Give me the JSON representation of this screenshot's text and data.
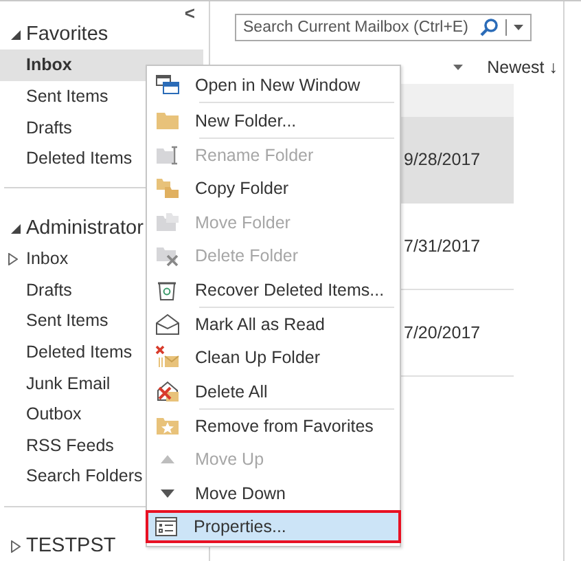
{
  "sidebar": {
    "collapse_button": "<",
    "groups": [
      {
        "title": "Favorites",
        "expanded": true,
        "items": [
          {
            "label": "Inbox",
            "selected": true,
            "has_children": false
          },
          {
            "label": "Sent Items",
            "selected": false,
            "has_children": false
          },
          {
            "label": "Drafts",
            "selected": false,
            "has_children": false
          },
          {
            "label": "Deleted Items",
            "selected": false,
            "has_children": false
          }
        ]
      },
      {
        "title": "Administrator",
        "expanded": true,
        "items": [
          {
            "label": "Inbox",
            "selected": false,
            "has_children": true
          },
          {
            "label": "Drafts",
            "selected": false,
            "has_children": false
          },
          {
            "label": "Sent Items",
            "selected": false,
            "has_children": false
          },
          {
            "label": "Deleted Items",
            "selected": false,
            "has_children": false
          },
          {
            "label": "Junk Email",
            "selected": false,
            "has_children": false
          },
          {
            "label": "Outbox",
            "selected": false,
            "has_children": false
          },
          {
            "label": "RSS Feeds",
            "selected": false,
            "has_children": false
          },
          {
            "label": "Search Folders",
            "selected": false,
            "has_children": false
          }
        ]
      },
      {
        "title": "TESTPST",
        "expanded": false
      }
    ]
  },
  "search": {
    "placeholder": "Search Current Mailbox (Ctrl+E)"
  },
  "sort": {
    "label": "Newest ↓"
  },
  "messages": [
    {
      "date": "9/28/2017",
      "selected": true
    },
    {
      "date": "7/31/2017",
      "selected": false
    },
    {
      "date": "7/20/2017",
      "selected": false
    }
  ],
  "context_menu": {
    "items": [
      {
        "label": "Open in New Window",
        "disabled": false,
        "separator_before": false,
        "selected": false
      },
      {
        "label": "New Folder...",
        "disabled": false,
        "separator_before": true,
        "selected": false
      },
      {
        "label": "Rename Folder",
        "disabled": true,
        "separator_before": true,
        "selected": false
      },
      {
        "label": "Copy Folder",
        "disabled": false,
        "separator_before": false,
        "selected": false
      },
      {
        "label": "Move Folder",
        "disabled": true,
        "separator_before": false,
        "selected": false
      },
      {
        "label": "Delete Folder",
        "disabled": true,
        "separator_before": false,
        "selected": false
      },
      {
        "label": "Recover Deleted Items...",
        "disabled": false,
        "separator_before": false,
        "selected": false
      },
      {
        "label": "Mark All as Read",
        "disabled": false,
        "separator_before": true,
        "selected": false
      },
      {
        "label": "Clean Up Folder",
        "disabled": false,
        "separator_before": false,
        "selected": false
      },
      {
        "label": "Delete All",
        "disabled": false,
        "separator_before": false,
        "selected": false
      },
      {
        "label": "Remove from Favorites",
        "disabled": false,
        "separator_before": true,
        "selected": false
      },
      {
        "label": "Move Up",
        "disabled": true,
        "separator_before": false,
        "selected": false
      },
      {
        "label": "Move Down",
        "disabled": false,
        "separator_before": false,
        "selected": false
      },
      {
        "label": "Properties...",
        "disabled": false,
        "separator_before": false,
        "selected": true
      }
    ]
  }
}
